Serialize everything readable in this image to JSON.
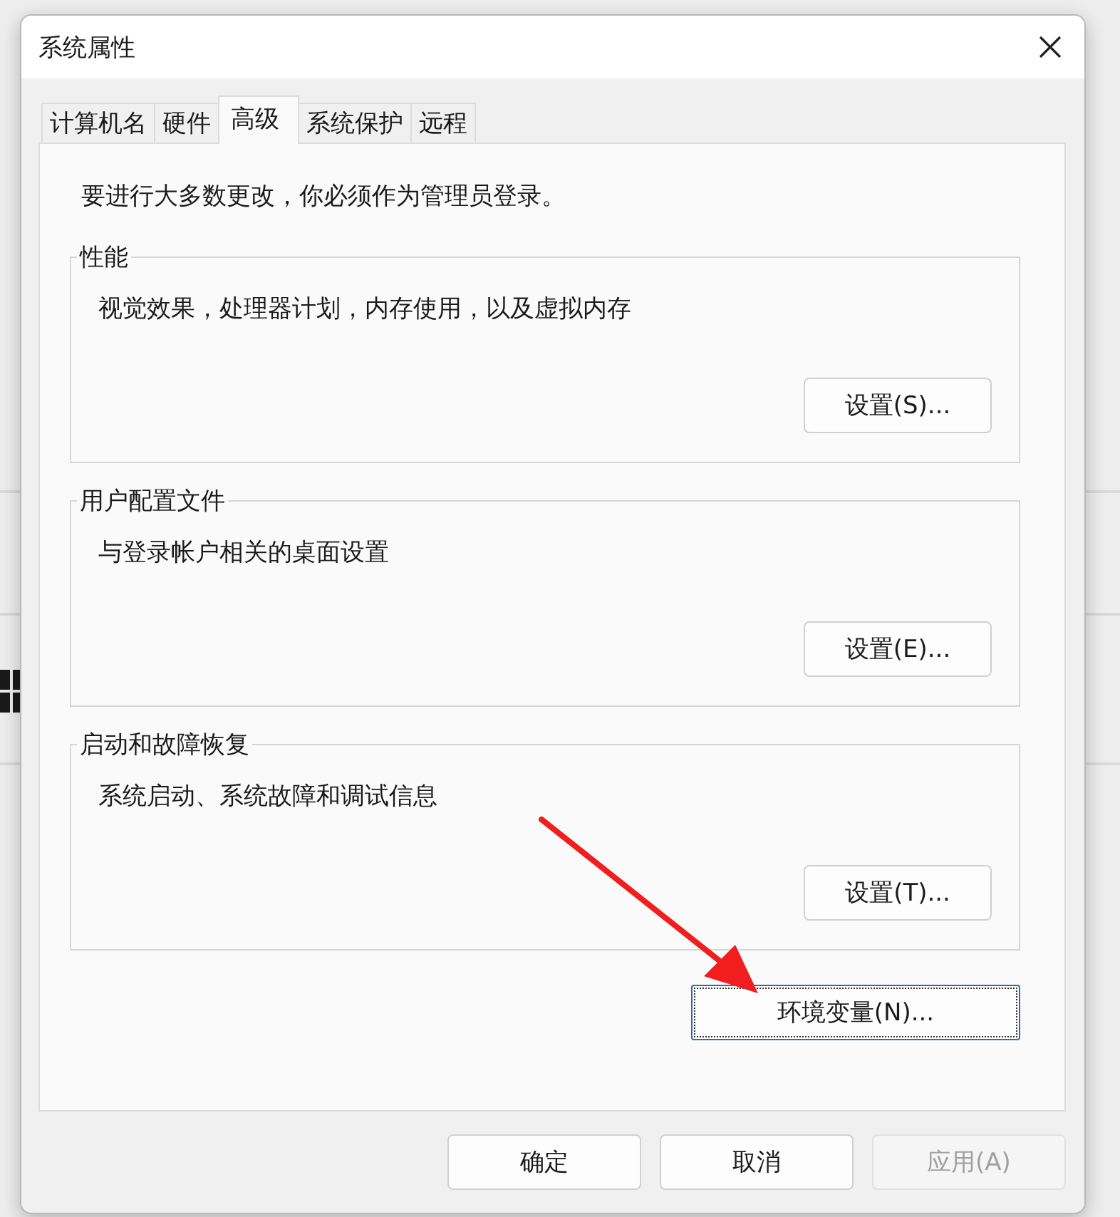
{
  "window": {
    "title": "系统属性"
  },
  "tabs": [
    {
      "label": "计算机名",
      "selected": false
    },
    {
      "label": "硬件",
      "selected": false
    },
    {
      "label": "高级",
      "selected": true
    },
    {
      "label": "系统保护",
      "selected": false
    },
    {
      "label": "远程",
      "selected": false
    }
  ],
  "notice": "要进行大多数更改，你必须作为管理员登录。",
  "groups": [
    {
      "title": "性能",
      "description": "视觉效果，处理器计划，内存使用，以及虚拟内存",
      "button": "设置(S)..."
    },
    {
      "title": "用户配置文件",
      "description": "与登录帐户相关的桌面设置",
      "button": "设置(E)..."
    },
    {
      "title": "启动和故障恢复",
      "description": "系统启动、系统故障和调试信息",
      "button": "设置(T)..."
    }
  ],
  "env_button": {
    "label": "环境变量(N)...",
    "focused": true
  },
  "annotation": {
    "kind": "arrow"
  },
  "footer_buttons": [
    {
      "label": "确定",
      "disabled": false
    },
    {
      "label": "取消",
      "disabled": false
    },
    {
      "label": "应用(A)",
      "disabled": true
    }
  ]
}
